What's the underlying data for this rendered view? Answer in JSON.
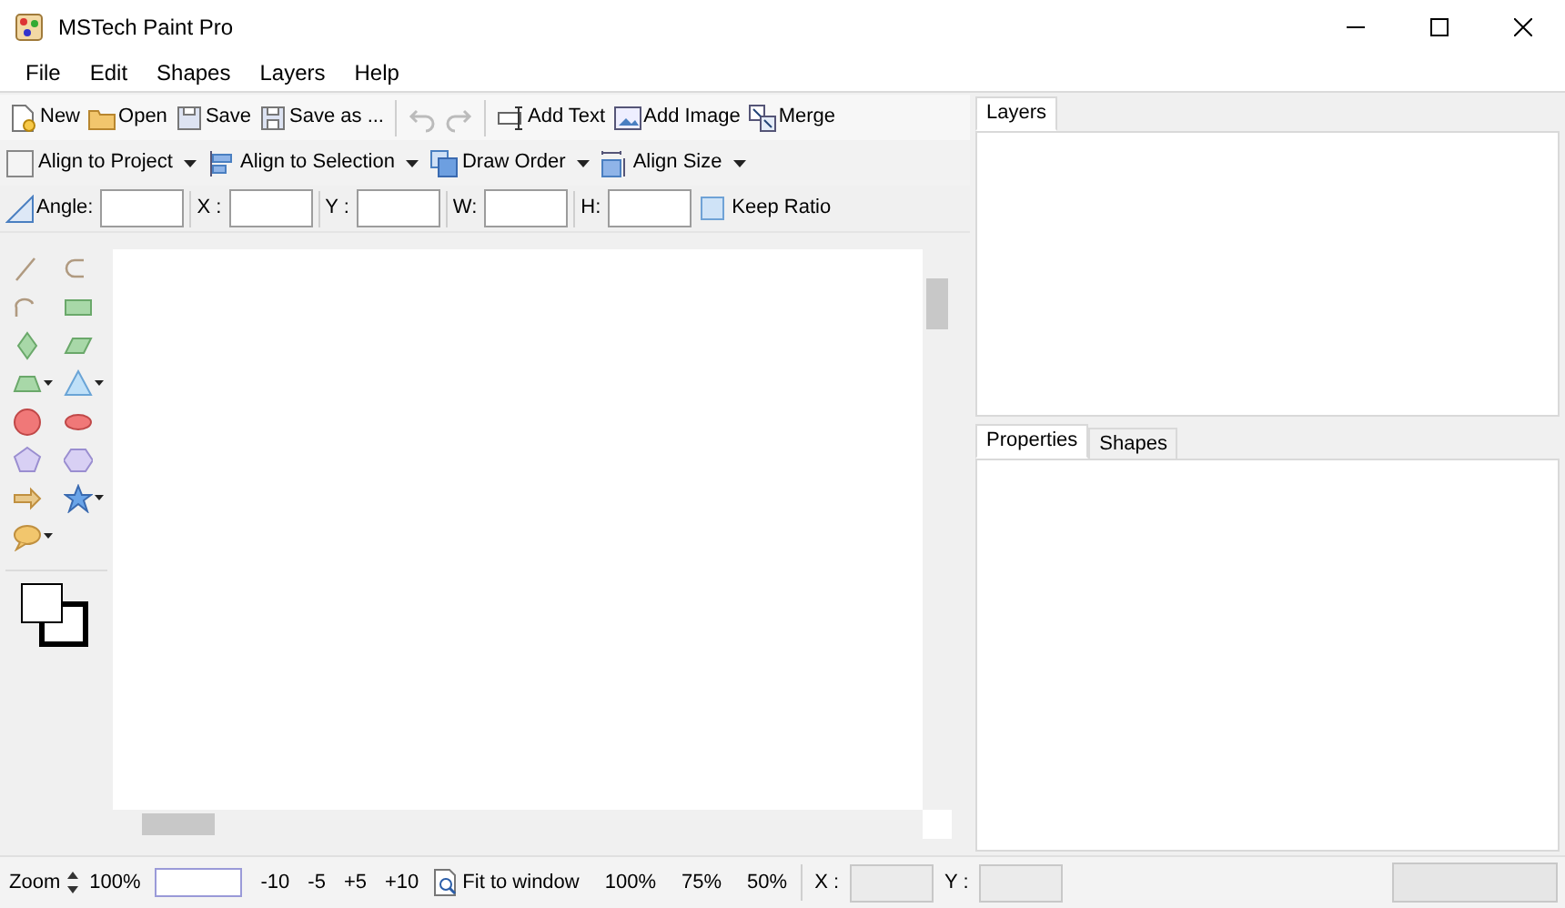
{
  "window": {
    "title": "MSTech Paint Pro"
  },
  "menu": [
    "File",
    "Edit",
    "Shapes",
    "Layers",
    "Help"
  ],
  "toolbar": {
    "groups": [
      [
        {
          "kind": "new",
          "label": "New"
        },
        {
          "kind": "open",
          "label": "Open"
        },
        {
          "kind": "save",
          "label": "Save"
        },
        {
          "kind": "save_as",
          "label": "Save as ..."
        }
      ],
      [
        {
          "kind": "undo",
          "disabled": true
        },
        {
          "kind": "redo",
          "disabled": true
        }
      ],
      [
        {
          "kind": "text",
          "label": "Add Text"
        },
        {
          "kind": "image",
          "label": "Add Image"
        },
        {
          "kind": "merge",
          "label": "Merge"
        }
      ]
    ]
  },
  "align_bar": [
    {
      "kind": "project",
      "label": "Align to Project",
      "dropdown": true
    },
    {
      "kind": "selection",
      "label": "Align to Selection",
      "dropdown": true
    },
    {
      "kind": "order",
      "label": "Draw Order",
      "dropdown": true
    },
    {
      "kind": "size",
      "label": "Align Size",
      "dropdown": true
    }
  ],
  "geometry_bar": {
    "fields": [
      {
        "label": "Angle:"
      },
      {
        "label": "X :"
      },
      {
        "label": "Y :"
      },
      {
        "label": "W:"
      },
      {
        "label": "H:"
      }
    ],
    "keep_ratio": {
      "label": "Keep Ratio",
      "checked": false
    }
  },
  "tools": [
    {
      "kind": "line",
      "dropdown": false
    },
    {
      "kind": "arc",
      "dropdown": false
    },
    {
      "kind": "arc2",
      "dropdown": false
    },
    {
      "kind": "rect",
      "dropdown": false
    },
    {
      "kind": "diamond",
      "dropdown": false
    },
    {
      "kind": "parallelogram",
      "dropdown": false
    },
    {
      "kind": "trapezoid",
      "dropdown": true
    },
    {
      "kind": "triangle",
      "dropdown": true
    },
    {
      "kind": "circle",
      "dropdown": false
    },
    {
      "kind": "ellipse",
      "dropdown": false
    },
    {
      "kind": "pentagon",
      "dropdown": false
    },
    {
      "kind": "hexagon",
      "dropdown": false
    },
    {
      "kind": "arrow",
      "dropdown": false
    },
    {
      "kind": "star",
      "dropdown": true
    },
    {
      "kind": "callout",
      "dropdown": true
    }
  ],
  "layers_panel": {
    "tabs": [
      {
        "label": "Layers",
        "selected": true
      }
    ]
  },
  "properties_panel": {
    "tabs": [
      {
        "label": "Properties",
        "selected": true
      },
      {
        "label": "Shapes",
        "selected": false
      }
    ]
  },
  "status_bar": {
    "zoom_label": "Zoom",
    "zoom_value": "100%",
    "steps": [
      "-10",
      "-5",
      "+5",
      "+10"
    ],
    "fit": "Fit to window",
    "presets": [
      "100%",
      "75%",
      "50%"
    ],
    "x_label": "X :",
    "y_label": "Y :"
  }
}
